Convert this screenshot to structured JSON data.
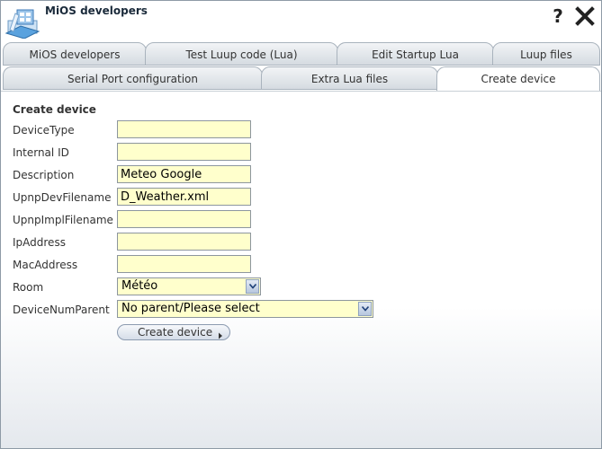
{
  "window": {
    "title": "MiOS developers"
  },
  "icons": {
    "help": "help-icon",
    "close": "close-icon",
    "logo": "mios-logo-icon",
    "dropdown": "chevron-down-icon",
    "button_arrow": "chevron-right-icon"
  },
  "tabs_row1": [
    {
      "label": "MiOS developers"
    },
    {
      "label": "Test Luup code (Lua)"
    },
    {
      "label": "Edit Startup Lua"
    },
    {
      "label": "Luup files"
    }
  ],
  "tabs_row2": [
    {
      "label": "Serial Port configuration"
    },
    {
      "label": "Extra Lua files"
    },
    {
      "label": "Create device",
      "active": true
    }
  ],
  "form": {
    "section_title": "Create device",
    "fields": [
      {
        "label": "DeviceType",
        "value": ""
      },
      {
        "label": "Internal ID",
        "value": ""
      },
      {
        "label": "Description",
        "value": "Meteo Google"
      },
      {
        "label": "UpnpDevFilename",
        "value": "D_Weather.xml"
      },
      {
        "label": "UpnpImplFilename",
        "value": ""
      },
      {
        "label": "IpAddress",
        "value": ""
      },
      {
        "label": "MacAddress",
        "value": ""
      }
    ],
    "room": {
      "label": "Room",
      "selected": "Météo"
    },
    "parent": {
      "label": "DeviceNumParent",
      "selected": "No parent/Please select"
    },
    "submit_label": "Create device"
  },
  "colors": {
    "input_bg": "#ffffcc",
    "tab_border": "#a9b3bd",
    "accent": "#4a90d9"
  }
}
